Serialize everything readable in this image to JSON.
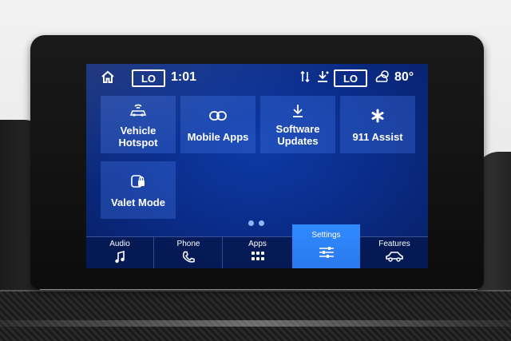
{
  "status": {
    "home_icon": "home-icon",
    "left_temp": "LO",
    "time": "1:01",
    "right_temp": "LO",
    "outside_temp": "80°"
  },
  "tiles": [
    {
      "label": "Vehicle Hotspot",
      "icon": "hotspot-car-icon"
    },
    {
      "label": "Mobile Apps",
      "icon": "link-icon"
    },
    {
      "label": "Software\nUpdates",
      "icon": "download-icon"
    },
    {
      "label": "911 Assist",
      "icon": "asterisk-icon"
    },
    {
      "label": "Valet Mode",
      "icon": "lock-icon"
    }
  ],
  "nav": [
    {
      "label": "Audio",
      "icon": "music-note-icon"
    },
    {
      "label": "Phone",
      "icon": "phone-icon"
    },
    {
      "label": "Apps",
      "icon": "grid-icon"
    },
    {
      "label": "Settings",
      "icon": "sliders-icon",
      "active": true
    },
    {
      "label": "Features",
      "icon": "car-icon"
    }
  ],
  "colors": {
    "screen_bg": "#0a2b86",
    "tile_bg": "#3c6edc",
    "active_tab": "#2f8bff"
  }
}
